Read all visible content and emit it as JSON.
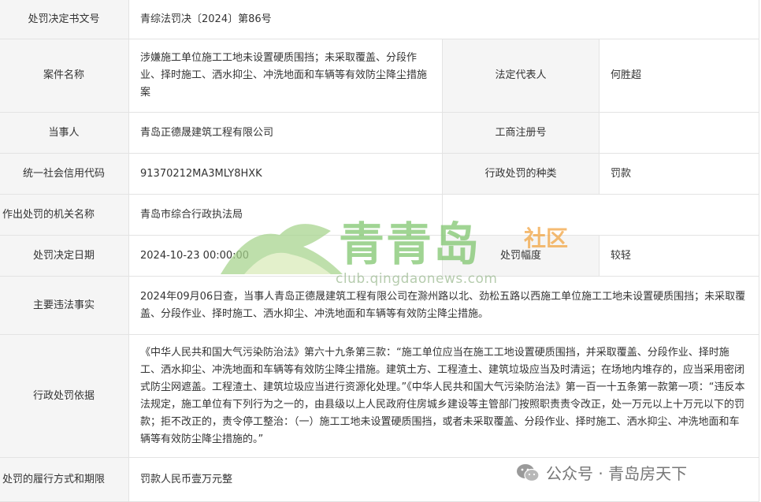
{
  "rows": {
    "doc_number": {
      "label": "处罚决定书文号",
      "value": "青综法罚决〔2024〕第86号"
    },
    "case_name": {
      "label": "案件名称",
      "value": "涉嫌施工单位施工工地未设置硬质围挡；未采取覆盖、分段作业、择时施工、洒水抑尘、冲洗地面和车辆等有效防尘降尘措施案"
    },
    "legal_rep": {
      "label": "法定代表人",
      "value": "何胜超"
    },
    "party": {
      "label": "当事人",
      "value": "青岛正德晟建筑工程有限公司"
    },
    "biz_reg": {
      "label": "工商注册号",
      "value": ""
    },
    "credit_code": {
      "label": "统一社会信用代码",
      "value": "91370212MA3MLY8HXK"
    },
    "penalty_type": {
      "label": "行政处罚的种类",
      "value": "罚款"
    },
    "authority": {
      "label": "作出处罚的机关名称",
      "value": "青岛市综合行政执法局"
    },
    "decision_date": {
      "label": "处罚决定日期",
      "value": "2024-10-23 00:00:00"
    },
    "penalty_range": {
      "label": "处罚幅度",
      "value": "较轻"
    },
    "facts": {
      "label": "主要违法事实",
      "value": "2024年09月06日查，当事人青岛正德晟建筑工程有限公司在滁州路以北、劲松五路以西施工单位施工工地未设置硬质围挡；未采取覆盖、分段作业、择时施工、洒水抑尘、冲洗地面和车辆等有效防尘降尘措施。"
    },
    "basis": {
      "label": "行政处罚依据",
      "value": "《中华人民共和国大气污染防治法》第六十九条第三款：“施工单位应当在施工工地设置硬质围挡，并采取覆盖、分段作业、择时施工、洒水抑尘、冲洗地面和车辆等有效防尘降尘措施。建筑土方、工程渣土、建筑垃圾应当及时清运；在场地内堆存的，应当采用密闭式防尘网遮盖。工程渣土、建筑垃圾应当进行资源化处理。”《中华人民共和国大气污染防治法》第一百一十五条第一款第一项：“违反本法规定，施工单位有下列行为之一的，由县级以上人民政府住房城乡建设等主管部门按照职责责令改正，处一万元以上十万元以下的罚款；拒不改正的，责令停工整治：（一）施工工地未设置硬质围挡，或者未采取覆盖、分段作业、择时施工、洒水抑尘、冲洗地面和车辆等有效防尘降尘措施的。”"
    },
    "execution": {
      "label": "处罚的履行方式和期限",
      "value": "罚款人民币壹万元整"
    }
  },
  "watermark": {
    "brand": "青青岛",
    "suffix": "社区",
    "url": "club.qingdaonews.com"
  },
  "credit": {
    "text": "公众号 · 青岛房天下",
    "icon": "wechat-icon"
  },
  "colors": {
    "label_bg": "#f5f5f5",
    "border": "#e3e3e3",
    "watermark_green": "#7cc46a",
    "watermark_orange": "#f2a23c"
  }
}
